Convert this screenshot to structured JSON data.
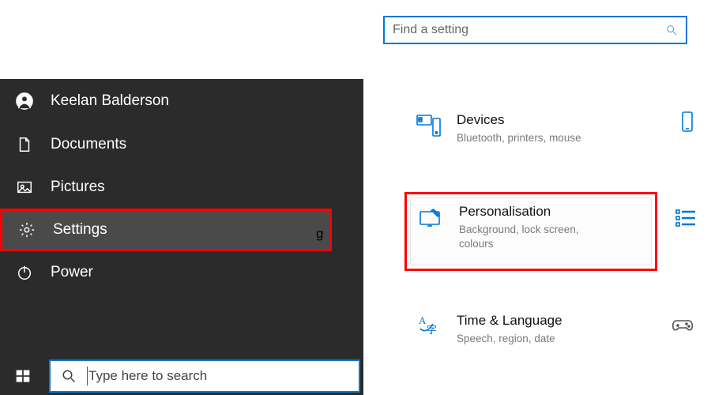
{
  "search": {
    "placeholder": "Find a setting"
  },
  "start": {
    "user": "Keelan Balderson",
    "documents": "Documents",
    "pictures": "Pictures",
    "settings": "Settings",
    "power": "Power"
  },
  "taskbar": {
    "placeholder": "Type here to search"
  },
  "stray": "g",
  "chevron": "⌄",
  "tiles": {
    "devices": {
      "title": "Devices",
      "sub": "Bluetooth, printers, mouse"
    },
    "personalisation": {
      "title": "Personalisation",
      "sub": "Background, lock screen, colours"
    },
    "time": {
      "title": "Time & Language",
      "sub": "Speech, region, date"
    }
  }
}
